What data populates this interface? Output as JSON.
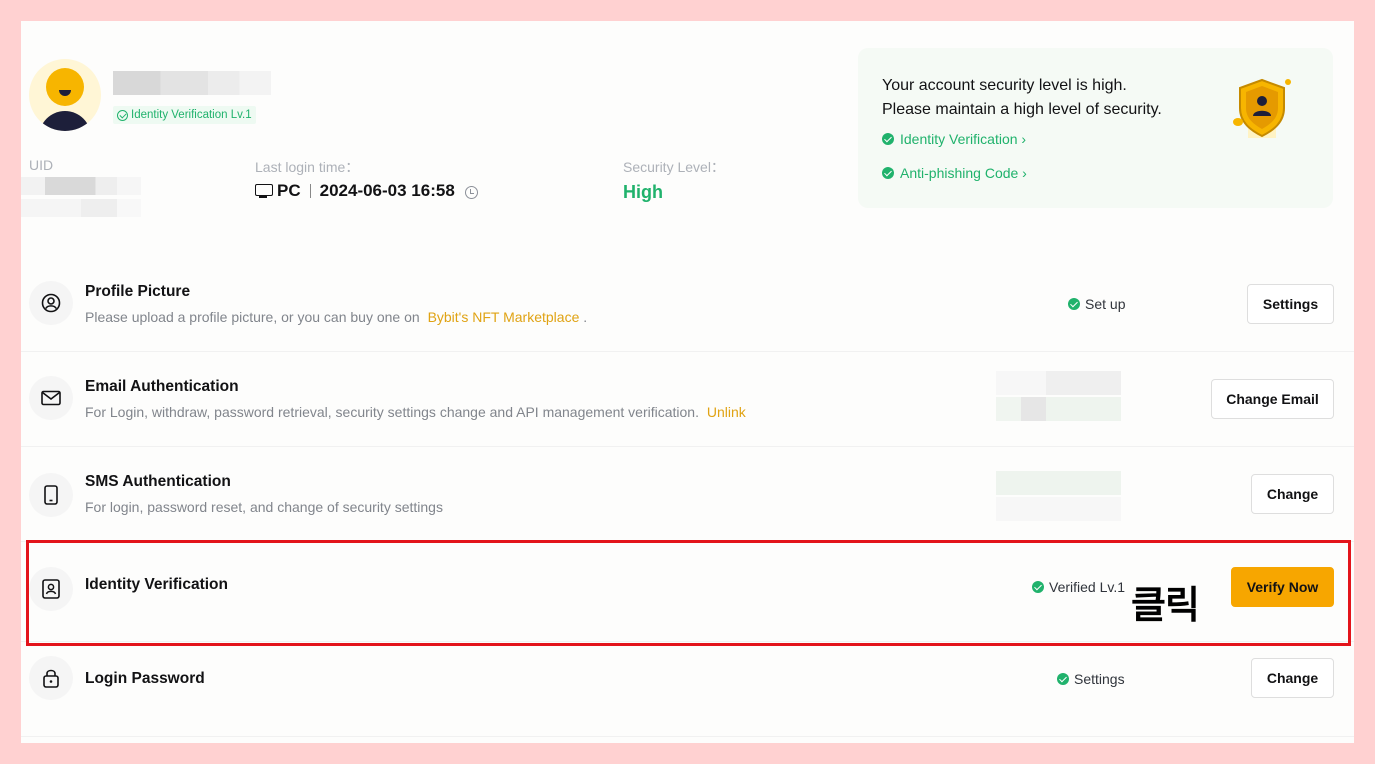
{
  "profile": {
    "badge": "Identity Verification Lv.1",
    "uid_label": "UID",
    "last_login_label": "Last login time：",
    "device": "PC",
    "last_login_time": "2024-06-03 16:58",
    "security_level_label": "Security Level：",
    "security_level": "High"
  },
  "security_panel": {
    "line1": "Your account security level is high.",
    "line2": "Please maintain a high level of security.",
    "links": [
      "Identity Verification ›",
      "Anti-phishing Code ›"
    ]
  },
  "rows": [
    {
      "title": "Profile Picture",
      "desc": "Please upload a profile picture, or you can buy one on",
      "link": "Bybit's NFT Marketplace",
      "desc_suffix": ".",
      "status": "Set up",
      "button": "Settings",
      "icon": "user-circle-icon"
    },
    {
      "title": "Email Authentication",
      "desc": "For Login, withdraw, password retrieval, security settings change and API management verification.",
      "link": "Unlink",
      "button": "Change Email",
      "icon": "envelope-icon"
    },
    {
      "title": "SMS Authentication",
      "desc": "For login, password reset, and change of security settings",
      "button": "Change",
      "icon": "phone-icon"
    },
    {
      "title": "Identity Verification",
      "status": "Verified Lv.1",
      "button": "Verify Now",
      "icon": "id-card-icon"
    },
    {
      "title": "Login Password",
      "status": "Settings",
      "button": "Change",
      "icon": "lock-icon"
    }
  ],
  "annotation": "클릭",
  "colors": {
    "accent": "#f7a600",
    "success": "#20b26c",
    "link": "#e0a314",
    "highlight_border": "#e3141b",
    "page_border": "#ffd1d1"
  }
}
